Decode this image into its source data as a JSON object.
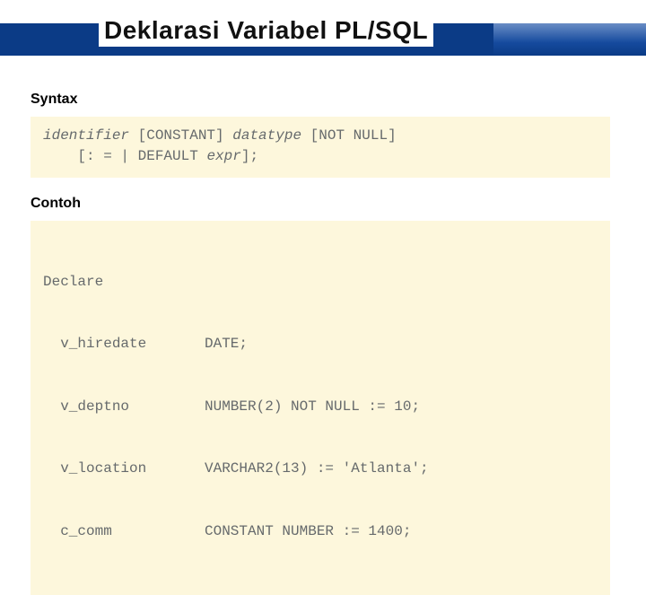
{
  "title": "Deklarasi Variabel PL/SQL",
  "syntax": {
    "heading": "Syntax",
    "line1_identifier": "identifier",
    "line1_rest": " [CONSTANT] ",
    "line1_datatype": "datatype",
    "line1_tail": " [NOT NULL]",
    "line2_prefix": "    [: = | DEFAULT ",
    "line2_expr": "expr",
    "line2_suffix": "];"
  },
  "example": {
    "heading": "Contoh",
    "declare": "Declare",
    "rows": [
      {
        "name": "  v_hiredate",
        "def": "DATE;"
      },
      {
        "name": "  v_deptno",
        "def": "NUMBER(2) NOT NULL := 10;"
      },
      {
        "name": "  v_location",
        "def": "VARCHAR2(13) := 'Atlanta';"
      },
      {
        "name": "  c_comm",
        "def": "CONSTANT NUMBER := 1400;"
      }
    ]
  }
}
